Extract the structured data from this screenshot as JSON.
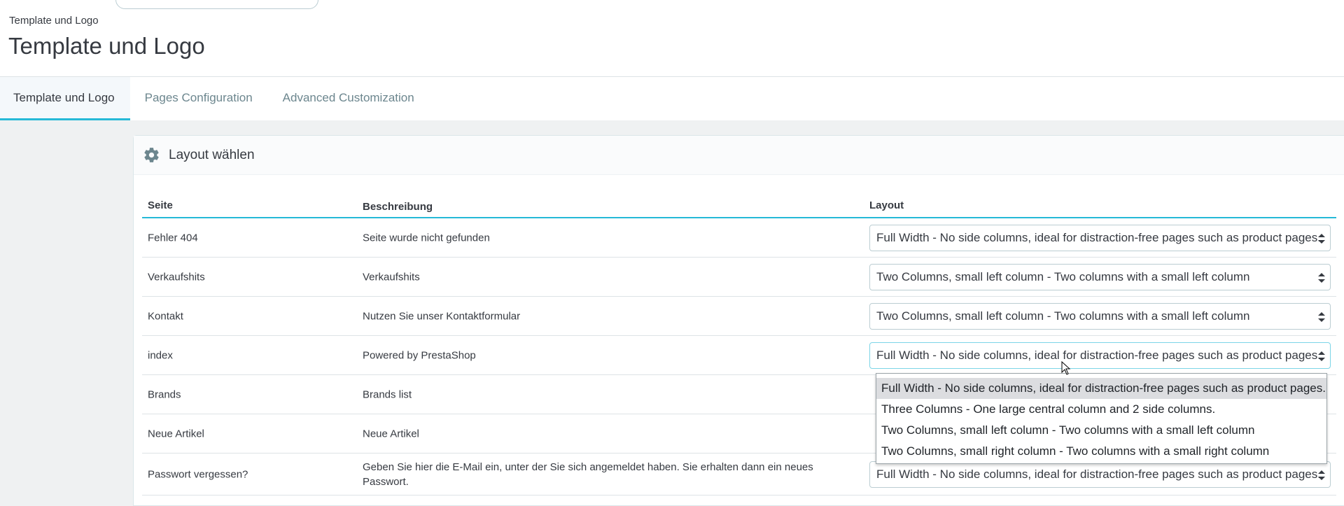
{
  "header": {
    "breadcrumb": "Template und Logo",
    "title": "Template und Logo"
  },
  "tabs": [
    {
      "label": "Template und Logo",
      "active": true
    },
    {
      "label": "Pages Configuration",
      "active": false
    },
    {
      "label": "Advanced Customization",
      "active": false
    }
  ],
  "panel": {
    "title": "Layout wählen",
    "icon": "gear-icon"
  },
  "table": {
    "headers": [
      "Seite",
      "Beschreibung",
      "Layout"
    ],
    "rows": [
      {
        "page": "Fehler 404",
        "description": "Seite wurde nicht gefunden",
        "layout": "Full Width - No side columns, ideal for distraction-free pages such as product pages."
      },
      {
        "page": "Verkaufshits",
        "description": "Verkaufshits",
        "layout": "Two Columns, small left column - Two columns with a small left column"
      },
      {
        "page": "Kontakt",
        "description": "Nutzen Sie unser Kontaktformular",
        "layout": "Two Columns, small left column - Two columns with a small left column"
      },
      {
        "page": "index",
        "description": "Powered by PrestaShop",
        "layout": "Full Width - No side columns, ideal for distraction-free pages such as product pages."
      },
      {
        "page": "Brands",
        "description": "Brands list",
        "layout": ""
      },
      {
        "page": "Neue Artikel",
        "description": "Neue Artikel",
        "layout": ""
      },
      {
        "page": "Passwort vergessen?",
        "description": "Geben Sie hier die E-Mail ein, unter der Sie sich angemeldet haben. Sie erhalten dann ein neues Passwort.",
        "layout": "Full Width - No side columns, ideal for distraction-free pages such as product pages."
      }
    ]
  },
  "dropdown": {
    "options": [
      "Full Width - No side columns, ideal for distraction-free pages such as product pages.",
      "Three Columns - One large central column and 2 side columns.",
      "Two Columns, small left column - Two columns with a small left column",
      "Two Columns, small right column - Two columns with a small right column"
    ],
    "highlighted_index": 0
  },
  "colors": {
    "accent": "#25b9d7",
    "text": "#363a41",
    "muted": "#6c868e",
    "background": "#eff1f2"
  }
}
